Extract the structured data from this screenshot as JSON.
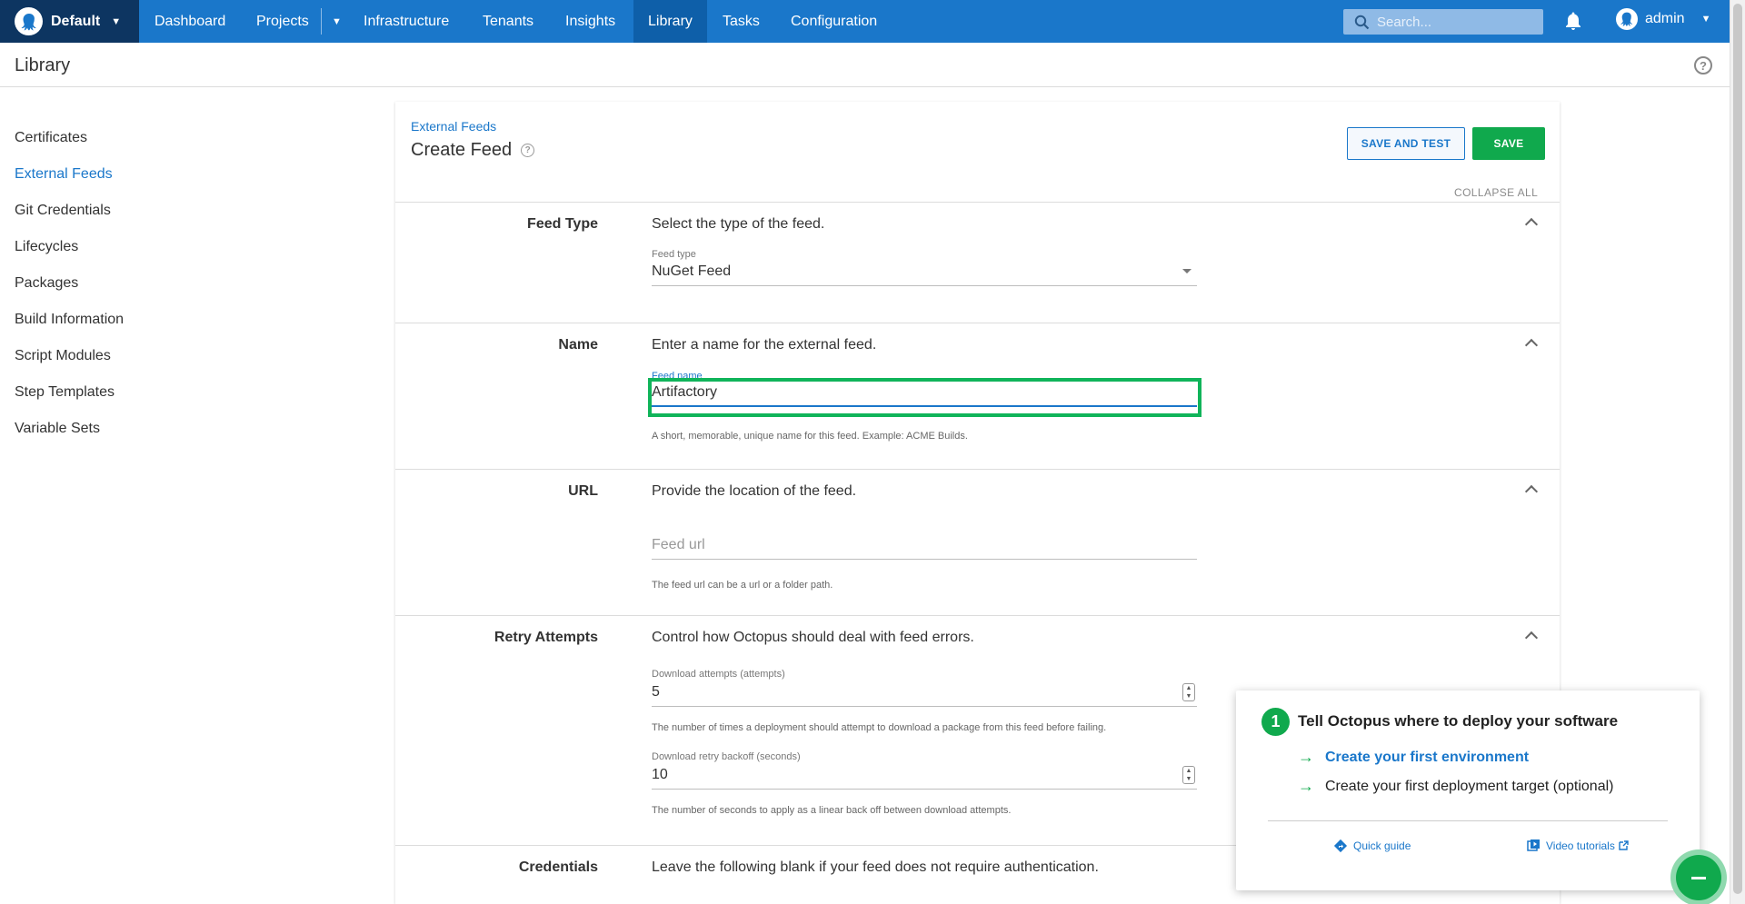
{
  "topbar": {
    "space_name": "Default",
    "nav": [
      "Dashboard",
      "Projects",
      "Infrastructure",
      "Tenants",
      "Insights",
      "Library",
      "Tasks",
      "Configuration"
    ],
    "active_nav": "Library",
    "search_placeholder": "Search...",
    "user": "admin",
    "colors": {
      "bar": "#1a77ca",
      "space": "#0d3561",
      "active": "#0e5fa9"
    }
  },
  "page": {
    "title": "Library"
  },
  "sidebar": {
    "items": [
      "Certificates",
      "External Feeds",
      "Git Credentials",
      "Lifecycles",
      "Packages",
      "Build Information",
      "Script Modules",
      "Step Templates",
      "Variable Sets"
    ],
    "active": "External Feeds"
  },
  "card": {
    "breadcrumb": "External Feeds",
    "title": "Create Feed",
    "save_and_test": "SAVE AND TEST",
    "save": "SAVE",
    "collapse_all": "COLLAPSE ALL"
  },
  "sections": {
    "feed_type": {
      "label": "Feed Type",
      "desc": "Select the type of the feed.",
      "field_label": "Feed type",
      "value": "NuGet Feed"
    },
    "name": {
      "label": "Name",
      "desc": "Enter a name for the external feed.",
      "field_label": "Feed name",
      "value": "Artifactory",
      "helper": "A short, memorable, unique name for this feed. Example: ACME Builds."
    },
    "url": {
      "label": "URL",
      "desc": "Provide the location of the feed.",
      "placeholder": "Feed url",
      "helper": "The feed url can be a url or a folder path."
    },
    "retry": {
      "label": "Retry Attempts",
      "desc": "Control how Octopus should deal with feed errors.",
      "attempts_label": "Download attempts (attempts)",
      "attempts_value": "5",
      "attempts_helper": "The number of times a deployment should attempt to download a package from this feed before failing.",
      "backoff_label": "Download retry backoff (seconds)",
      "backoff_value": "10",
      "backoff_helper": "The number of seconds to apply as a linear back off between download attempts."
    },
    "credentials": {
      "label": "Credentials",
      "desc": "Leave the following blank if your feed does not require authentication."
    }
  },
  "onboarding": {
    "step": "1",
    "title": "Tell Octopus where to deploy your software",
    "link1": "Create your first environment",
    "link2": "Create your first deployment target (optional)",
    "quick_guide": "Quick guide",
    "video_tutorials": "Video tutorials",
    "accent": "#10a94d"
  }
}
